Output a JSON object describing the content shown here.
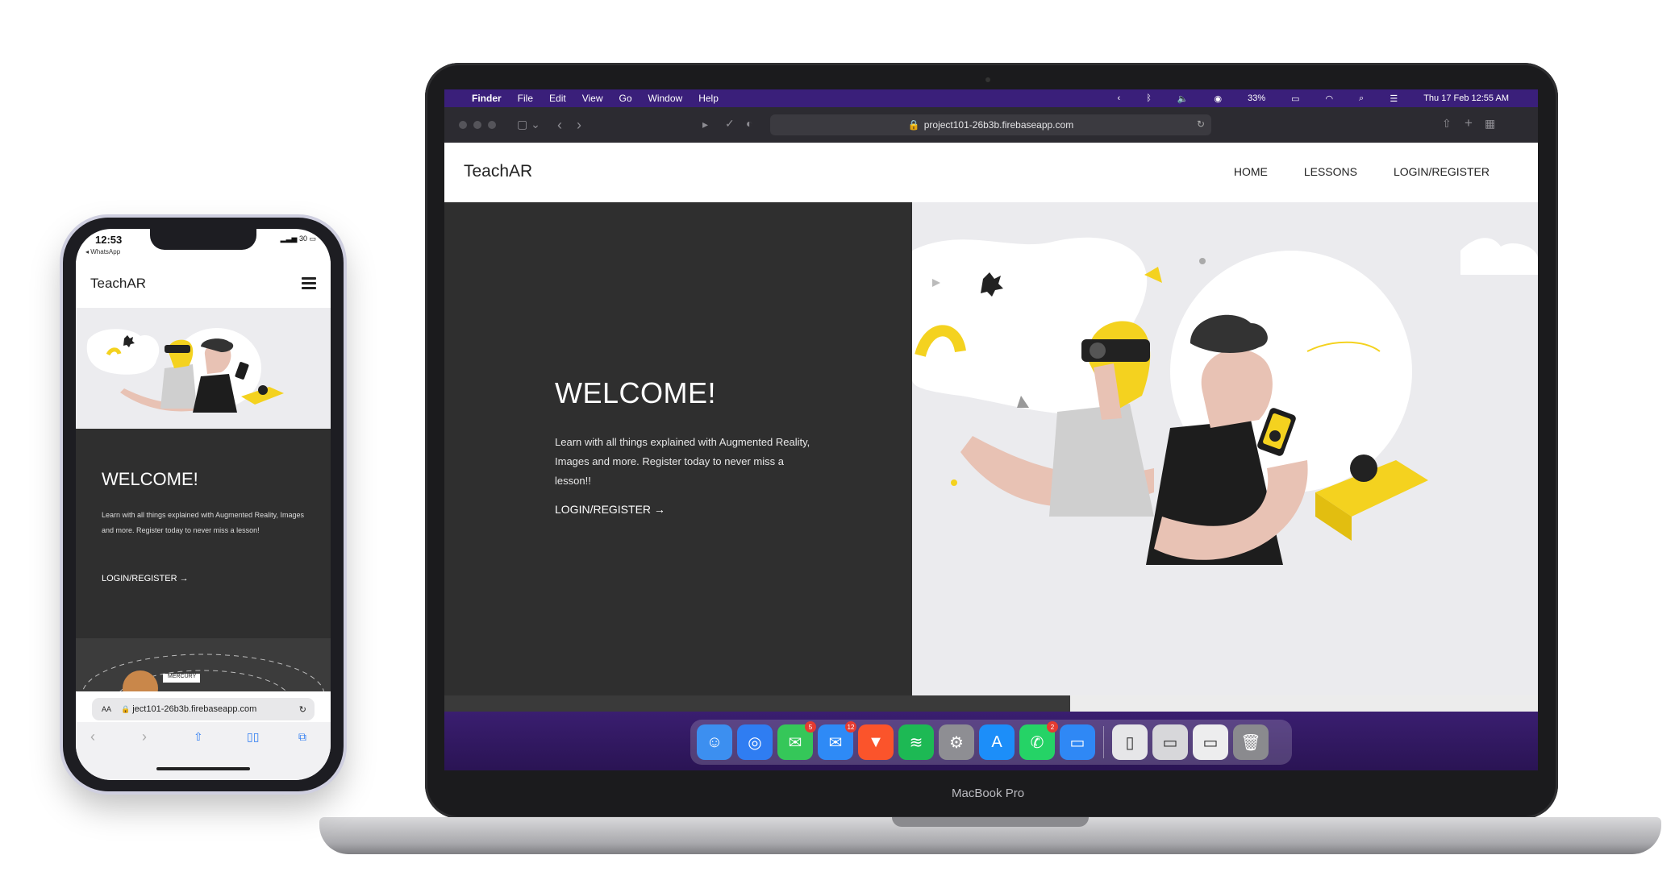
{
  "laptop": {
    "menubar": {
      "apple": "",
      "items": [
        "Finder",
        "File",
        "Edit",
        "View",
        "Go",
        "Window",
        "Help"
      ],
      "battery": "33%",
      "clock": "Thu 17 Feb  12:55 AM"
    },
    "browser": {
      "url": "project101-26b3b.firebaseapp.com"
    },
    "site": {
      "logo": "TeachAR",
      "nav": [
        "HOME",
        "LESSONS",
        "LOGIN/REGISTER"
      ],
      "hero_title": "WELCOME!",
      "hero_text": "Learn with all things explained with Augmented Reality, Images and more. Register today to never miss a lesson!!",
      "cta": "LOGIN/REGISTER →"
    },
    "dock": {
      "apps": [
        {
          "name": "finder",
          "color": "#3c8ff0",
          "glyph": "☺",
          "badge": ""
        },
        {
          "name": "safari",
          "color": "#2f7df2",
          "glyph": "◎",
          "badge": ""
        },
        {
          "name": "messages",
          "color": "#35c759",
          "glyph": "✉",
          "badge": "5"
        },
        {
          "name": "mail",
          "color": "#2e8af6",
          "glyph": "✉",
          "badge": "12"
        },
        {
          "name": "brave",
          "color": "#fb542b",
          "glyph": "▼",
          "badge": ""
        },
        {
          "name": "spotify",
          "color": "#1db954",
          "glyph": "≋",
          "badge": ""
        },
        {
          "name": "system-preferences",
          "color": "#8e8e93",
          "glyph": "⚙",
          "badge": ""
        },
        {
          "name": "app-store",
          "color": "#1c8ef9",
          "glyph": "A",
          "badge": ""
        },
        {
          "name": "whatsapp",
          "color": "#25d366",
          "glyph": "✆",
          "badge": "2"
        },
        {
          "name": "keynote",
          "color": "#2f88f5",
          "glyph": "▭",
          "badge": ""
        },
        {
          "name": "document",
          "color": "#e6e6e8",
          "glyph": "▯",
          "badge": ""
        },
        {
          "name": "window-1",
          "color": "#d7d7da",
          "glyph": "▭",
          "badge": ""
        },
        {
          "name": "window-2",
          "color": "#ededee",
          "glyph": "▭",
          "badge": ""
        },
        {
          "name": "trash",
          "color": "#8a8a8e",
          "glyph": "🗑",
          "badge": ""
        }
      ]
    },
    "device_label": "MacBook Pro"
  },
  "phone": {
    "status": {
      "time": "12:53",
      "back_app": "◂ WhatsApp",
      "battery": "30"
    },
    "site": {
      "logo": "TeachAR",
      "hero_title": "WELCOME!",
      "hero_text": "Learn with all things explained with Augmented Reality, Images and more. Register today to never miss a lesson!",
      "cta": "LOGIN/REGISTER →",
      "galaxy_label": "MERCURY"
    },
    "browser": {
      "aa": "AA",
      "url": "ject101-26b3b.firebaseapp.com"
    }
  }
}
